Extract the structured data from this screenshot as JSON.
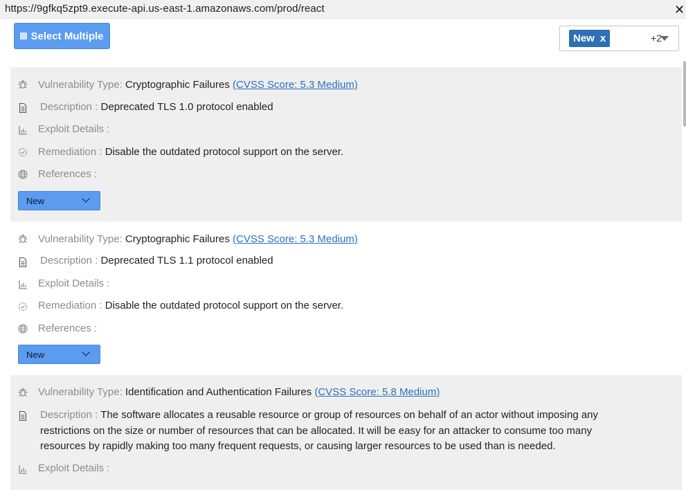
{
  "browser": {
    "url": "https://9gfkq5zpt9.execute-api.us-east-1.amazonaws.com/prod/react",
    "close_label": "✕"
  },
  "toolbar": {
    "select_multiple_label": "Select Multiple",
    "filter_tag_label": "New",
    "filter_tag_remove": "x",
    "filter_more": "+2"
  },
  "labels": {
    "vuln_type": "Vulnerability Type:",
    "description": "Description :",
    "exploit": "Exploit Details :",
    "remediation": "Remediation :",
    "references": "References :"
  },
  "findings": [
    {
      "vuln_type": "Cryptographic Failures",
      "cvss": "(CVSS Score: 5.3 Medium)",
      "description": "Deprecated TLS 1.0 protocol enabled",
      "exploit": "",
      "remediation": "Disable the outdated protocol support on the server.",
      "references": "",
      "status": "New"
    },
    {
      "vuln_type": "Cryptographic Failures",
      "cvss": "(CVSS Score: 5.3 Medium)",
      "description": "Deprecated TLS 1.1 protocol enabled",
      "exploit": "",
      "remediation": "Disable the outdated protocol support on the server.",
      "references": "",
      "status": "New"
    },
    {
      "vuln_type": "Identification and Authentication Failures",
      "cvss": "(CVSS Score: 5.8 Medium)",
      "description_lines": [
        "The software allocates a reusable resource or group of resources on behalf of an actor without imposing any",
        "restrictions on the size or number of resources that can be allocated. It will be easy for an attacker to consume too many",
        "resources by rapidly making too many frequent requests, or causing larger resources to be used than is needed."
      ],
      "exploit": ""
    }
  ],
  "colors": {
    "accent": "#5b9bf0",
    "tag": "#2e6fb5",
    "link": "#2a6fc0",
    "card_grey": "#efefef"
  },
  "icons": [
    "bug-icon",
    "document-icon",
    "exploit-icon",
    "remediation-badge-icon",
    "globe-icon",
    "chevron-down-icon"
  ]
}
